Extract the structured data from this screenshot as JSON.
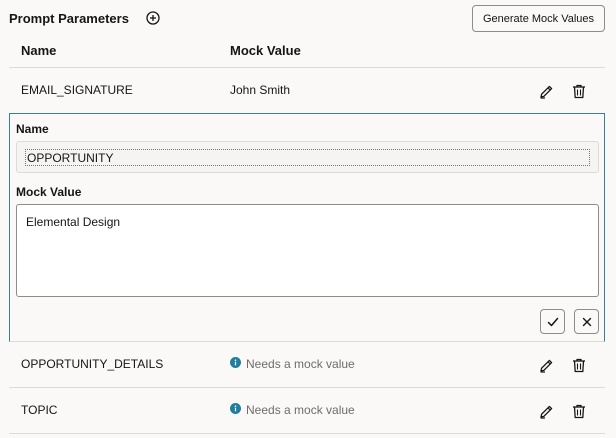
{
  "header": {
    "title": "Prompt Parameters",
    "add_icon": "plus-circle-icon",
    "generate_label": "Generate Mock Values"
  },
  "columns": {
    "name": "Name",
    "mock_value": "Mock Value"
  },
  "rows": [
    {
      "name": "EMAIL_SIGNATURE",
      "value": "John Smith",
      "needs_value": false
    },
    {
      "name": "OPPORTUNITY_DETAILS",
      "value": "Needs a mock value",
      "needs_value": true
    },
    {
      "name": "TOPIC",
      "value": "Needs a mock value",
      "needs_value": true
    }
  ],
  "edit_panel": {
    "name_label": "Name",
    "name_value": "OPPORTUNITY",
    "mock_label": "Mock Value",
    "mock_value": "Elemental Design",
    "confirm_icon": "checkmark-icon",
    "cancel_icon": "close-icon"
  },
  "colors": {
    "accent": "#3b7f94",
    "info": "#227e9e",
    "divider": "#dedbd7",
    "background": "#fbf9f8"
  },
  "icons": {
    "edit": "pencil-icon",
    "delete": "trash-icon",
    "info": "info-icon"
  }
}
